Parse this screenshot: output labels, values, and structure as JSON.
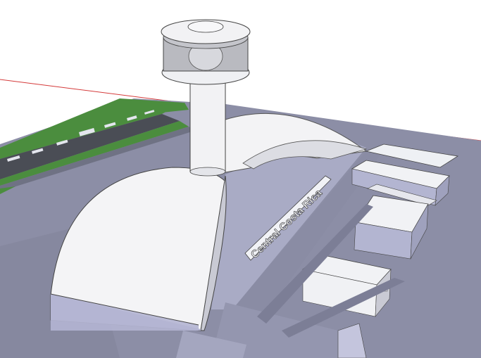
{
  "viewport": {
    "background": "#ffffff",
    "axis_color": "#d43a3a"
  },
  "terrain": {
    "ground_color": "#8c8ea6",
    "ground_shade": "#7f8198",
    "grass_color": "#4b8d3e",
    "runway_color": "#4a4d55",
    "marking_color": "#e4e6ee"
  },
  "terminal": {
    "sign_text": "Central Costa Rica",
    "sign_color": "#f1f2f6",
    "roof_light": "#f3f3f5",
    "roof_shade": "#c9cad4",
    "wall_color": "#a7a9c6"
  },
  "control_tower": {
    "glass_color": "#b9bac0",
    "shaft_color": "#f2f2f4"
  }
}
